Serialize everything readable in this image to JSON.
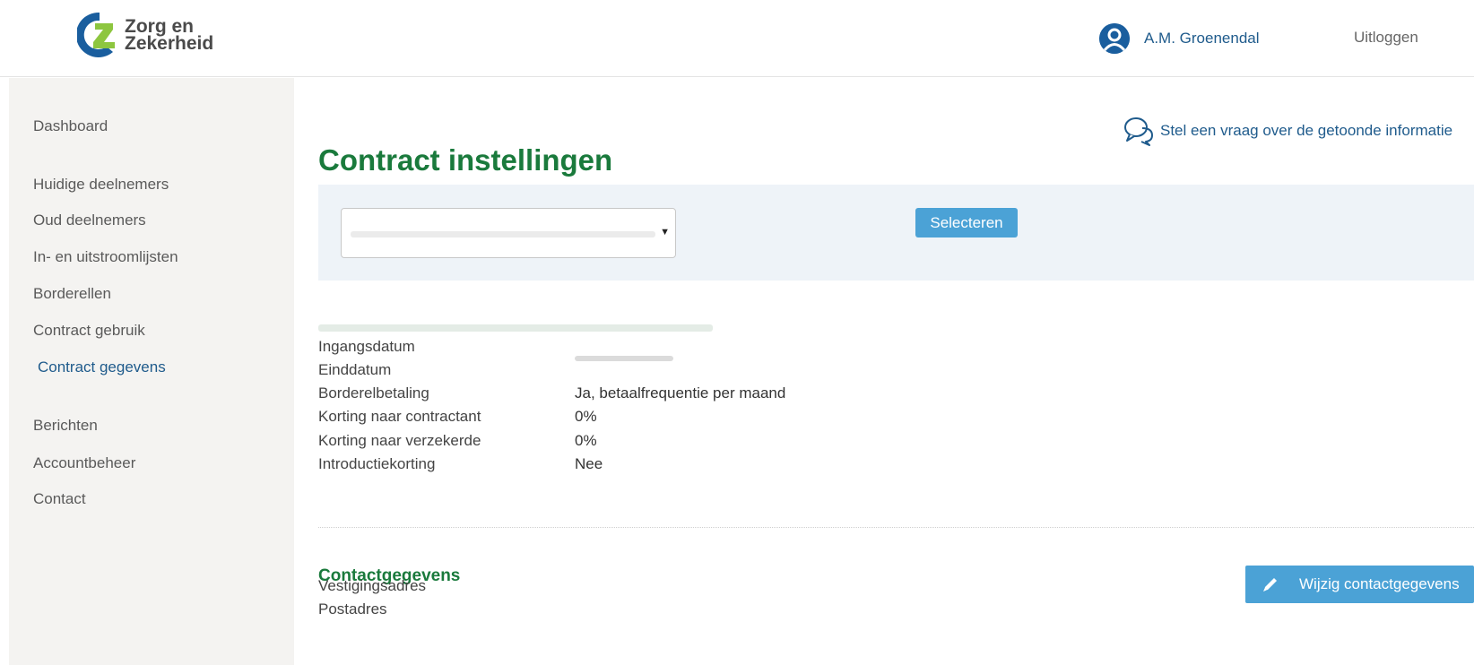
{
  "header": {
    "logo_line1": "Zorg en",
    "logo_line2": "Zekerheid",
    "user_name": "A.M. Groenendal",
    "logout_label": "Uitloggen"
  },
  "sidebar": {
    "items": [
      {
        "label": "Dashboard"
      },
      {
        "label": "Huidige deelnemers"
      },
      {
        "label": "Oud deelnemers"
      },
      {
        "label": "In- en uitstroomlijsten"
      },
      {
        "label": "Borderellen"
      },
      {
        "label": "Contract gebruik"
      },
      {
        "label": "Contract gegevens"
      },
      {
        "label": "Berichten"
      },
      {
        "label": "Accountbeheer"
      },
      {
        "label": "Contact"
      }
    ],
    "active_index": 6
  },
  "main": {
    "ask_link": "Stel een vraag over de getoonde informatie",
    "title": "Contract instellingen",
    "select_button": "Selecteren",
    "details": [
      {
        "label": "Ingangsdatum",
        "value": ""
      },
      {
        "label": "Einddatum",
        "value": ""
      },
      {
        "label": "Borderelbetaling",
        "value": "Ja, betaalfrequentie per maand"
      },
      {
        "label": "Korting naar contractant",
        "value": "0%"
      },
      {
        "label": "Korting naar verzekerde",
        "value": "0%"
      },
      {
        "label": "Introductiekorting",
        "value": "Nee"
      }
    ],
    "contact_title": "Contactgegevens",
    "edit_contact_button": "Wijzig contactgegevens",
    "contact_rows": [
      {
        "label": "Vestigingsadres"
      },
      {
        "label": "Postadres"
      }
    ]
  },
  "colors": {
    "brand_green": "#1a7a3c",
    "link_blue": "#1f5b8c",
    "button_blue": "#4ba2d6",
    "sidebar_bg": "#f4f3f1"
  },
  "icons": {
    "logo": "zz-logo-icon",
    "user": "user-icon",
    "ask": "chat-bubbles-icon",
    "dropdown": "triangle-down-icon",
    "edit": "pencil-icon"
  }
}
